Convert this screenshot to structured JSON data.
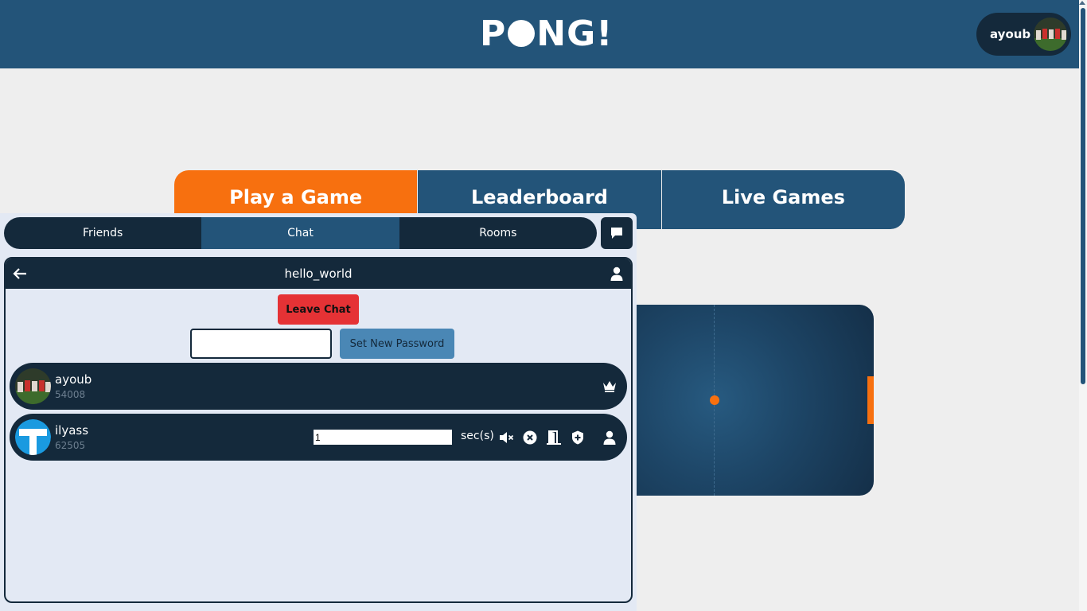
{
  "header": {
    "logo_left": "P",
    "logo_right": "NG!",
    "profile_name": "ayoub"
  },
  "main_tabs": [
    {
      "label": "Play a Game",
      "active": true
    },
    {
      "label": "Leaderboard",
      "active": false
    },
    {
      "label": "Live Games",
      "active": false
    }
  ],
  "panel": {
    "tabs": [
      {
        "label": "Friends"
      },
      {
        "label": "Chat",
        "active": true
      },
      {
        "label": "Rooms"
      }
    ],
    "room_title": "hello_world",
    "leave_label": "Leave Chat",
    "password_value": "",
    "set_password_label": "Set New Password",
    "members": [
      {
        "name": "ayoub",
        "score": "54008",
        "role_icon": "crown-icon"
      },
      {
        "name": "ilyass",
        "score": "62505",
        "mute_value": "1",
        "mute_unit": "sec(s)"
      }
    ]
  },
  "colors": {
    "primary": "#235479",
    "dark": "#14293b",
    "accent": "#f7700f",
    "danger": "#e53235"
  }
}
